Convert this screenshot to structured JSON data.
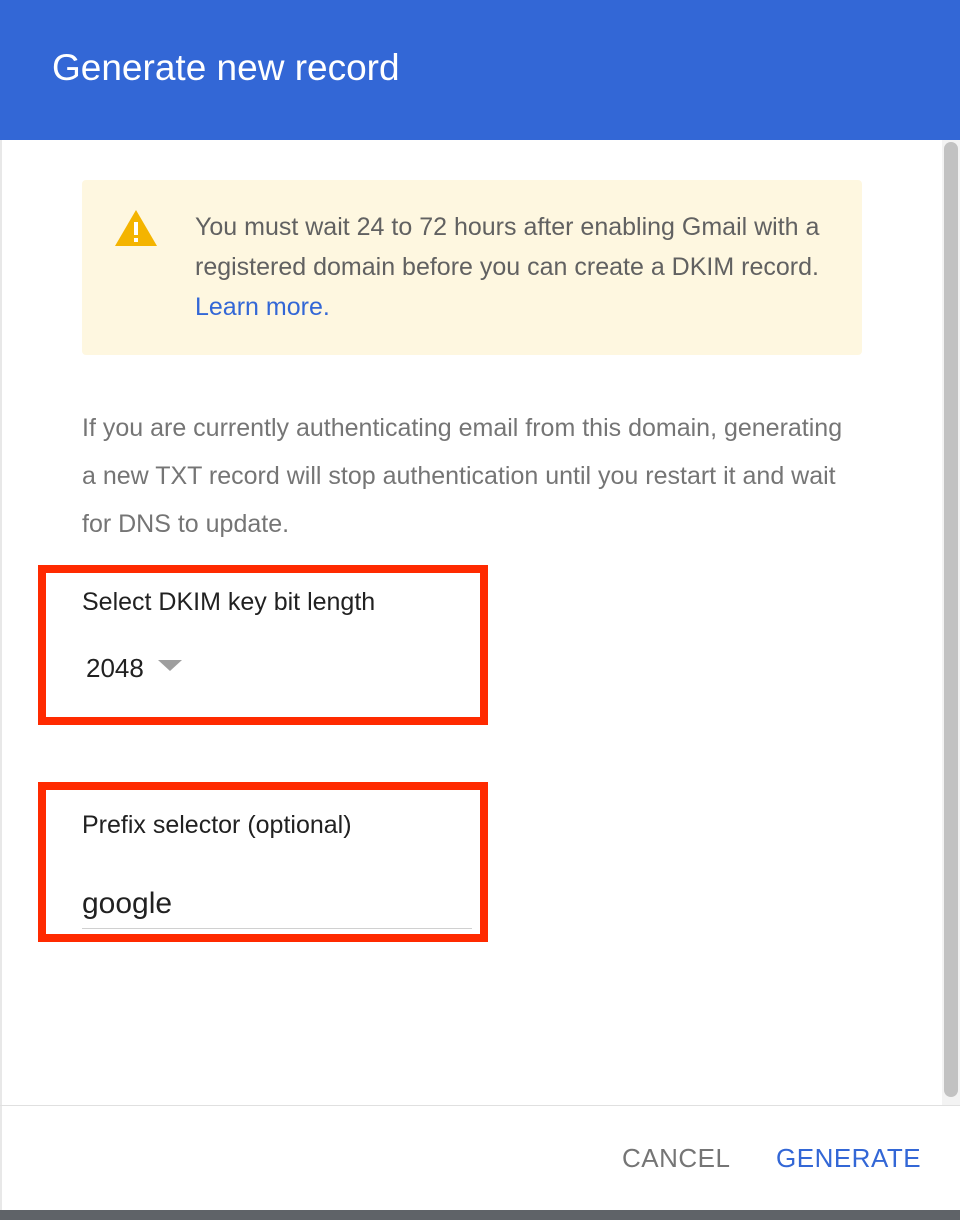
{
  "dialog": {
    "title": "Generate new record"
  },
  "warning": {
    "icon": "warning-icon",
    "icon_color": "#f4b400",
    "text": "You must wait 24 to 72 hours after enabling Gmail with a registered domain before you can create a DKIM record.",
    "link_text": "Learn more."
  },
  "info": {
    "text": "If you are currently authenticating email from this domain, generating a new TXT record will stop authentication until you restart it and wait for DNS to update."
  },
  "key_length": {
    "label": "Select DKIM key bit length",
    "value": "2048"
  },
  "prefix": {
    "label": "Prefix selector (optional)",
    "value": "google"
  },
  "footer": {
    "cancel_label": "CANCEL",
    "generate_label": "GENERATE"
  },
  "colors": {
    "header": "#3367d6",
    "accent": "#3367d6",
    "highlight": "#ff2a00",
    "warning_bg": "#fef7e0"
  }
}
